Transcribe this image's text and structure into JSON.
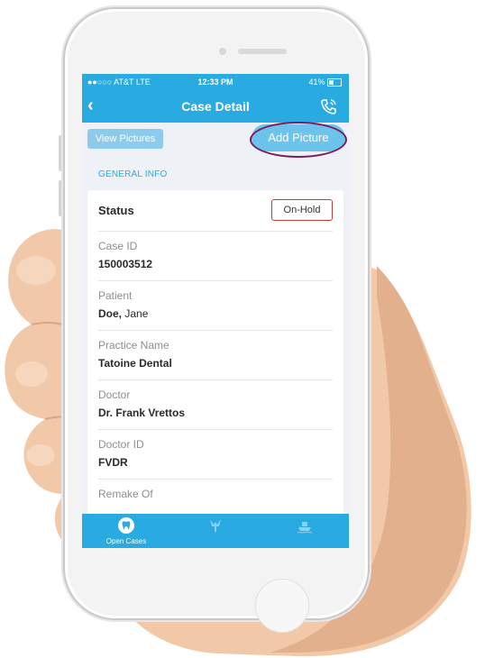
{
  "status_bar": {
    "carrier": "●●○○○ AT&T  LTE",
    "time": "12:33 PM",
    "battery": "41%"
  },
  "navbar": {
    "back_icon": "chevron-left-icon",
    "title": "Case Detail",
    "call_icon": "phone-ringing-icon"
  },
  "actions": {
    "view_pictures": "View Pictures",
    "add_picture": "Add Picture"
  },
  "section_title": "GENERAL INFO",
  "status": {
    "label": "Status",
    "value": "On-Hold"
  },
  "fields": [
    {
      "label": "Case ID",
      "value": "150003512"
    },
    {
      "label": "Patient",
      "value_bold": "Doe,",
      "value_rest": " Jane"
    },
    {
      "label": "Practice Name",
      "value": "Tatoine Dental"
    },
    {
      "label": "Doctor",
      "value": "Dr. Frank Vrettos"
    },
    {
      "label": "Doctor ID",
      "value": "FVDR"
    },
    {
      "label": "Remake Of",
      "value": ""
    }
  ],
  "tabs": [
    {
      "label": "Open Cases",
      "icon": "tooth-icon",
      "active": true
    },
    {
      "label": "",
      "icon": "implant-icon",
      "active": false
    },
    {
      "label": "",
      "icon": "ship-icon",
      "active": false
    }
  ],
  "colors": {
    "primary": "#29abe2",
    "badge_border": "#c93b3b",
    "highlight_oval": "#7d1a59"
  }
}
